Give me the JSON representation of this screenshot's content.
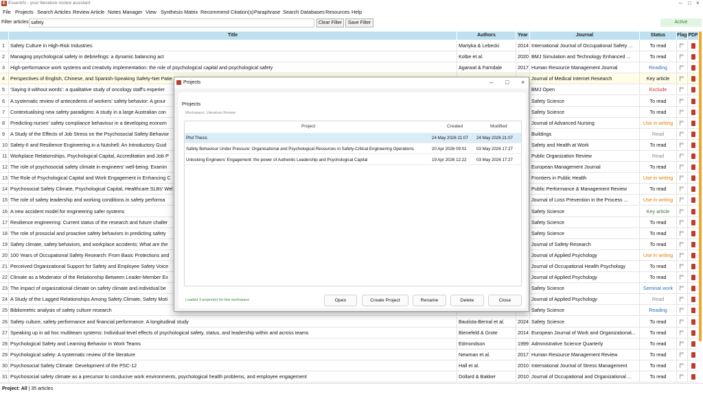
{
  "app": {
    "title": "EssentAI - your literature review assistant",
    "icon": "app-logo-icon"
  },
  "menu": [
    "File",
    "Projects",
    "Search Articles",
    "Review Article",
    "Notes Manager",
    "View",
    "Synthesis Matrix",
    "Recommend Citation(s)",
    "Paraphrase",
    "Search Databases",
    "Resources",
    "Help"
  ],
  "filter": {
    "label": "Filter articles:",
    "value": "safety",
    "clear_label": "Clear Filter",
    "save_label": "Save Filter",
    "status": "Active"
  },
  "table": {
    "headers": {
      "num": "",
      "title": "Title",
      "authors": "Authors",
      "year": "Year",
      "journal": "Journal",
      "status": "Status",
      "flag": "Flag",
      "pdf": "PDF"
    },
    "rows": [
      {
        "n": "1",
        "title": "Safety Culture in High-Risk Industries",
        "authors": "Martyka & Lebecki",
        "year": "2014",
        "journal": "International Journal of Occupational Safety ...",
        "status": "To read",
        "status_color": "#111111"
      },
      {
        "n": "2",
        "title": "Managing psychological safety in debriefings: a dynamic balancing act",
        "authors": "Kolbe et al.",
        "year": "2020",
        "journal": "BMJ Simulation and Technology Enhanced ...",
        "status": "To read",
        "status_color": "#111111"
      },
      {
        "n": "3",
        "title": "High-performance work systems and creativity implementation: the role of psychological capital and psychological safety",
        "authors": "Agarwal & Farndale",
        "year": "2017",
        "journal": "Human Resource Management Journal",
        "status": "Reading",
        "status_color": "#2f6fb5"
      },
      {
        "n": "4",
        "title": "Perspectives of English, Chinese, and Spanish-Speaking Safety-Net Patie",
        "authors": "",
        "year": "",
        "journal": "Journal of Medical Internet Research",
        "status": "Key article",
        "status_color": "#111111",
        "hl": true
      },
      {
        "n": "5",
        "title": "'Saying it without words': a qualitative study of oncology staff's experier",
        "authors": "",
        "year": "",
        "journal": "BMJ Open",
        "status": "Exclude",
        "status_color": "#d32f2f"
      },
      {
        "n": "6",
        "title": "A systematic review of antecedents of workers' safety behavior: A grour",
        "authors": "",
        "year": "",
        "journal": "Safety Science",
        "status": "To read",
        "status_color": "#111111"
      },
      {
        "n": "7",
        "title": "Contextualising new safety paradigms: A study in a large Australian con",
        "authors": "",
        "year": "",
        "journal": "Safety Science",
        "status": "To read",
        "status_color": "#111111"
      },
      {
        "n": "8",
        "title": "Predicting nurses' safety compliance behaviour in a developing econom",
        "authors": "",
        "year": "",
        "journal": "Journal of Advanced Nursing",
        "status": "Use in writing",
        "status_color": "#e07b00"
      },
      {
        "n": "9",
        "title": "A Study of the Effects of Job Stress on the Psychosocial Safety Behavior",
        "authors": "",
        "year": "",
        "journal": "Buildings",
        "status": "Read",
        "status_color": "#888888"
      },
      {
        "n": "10",
        "title": "Safety-II and Resilience Engineering in a Nutshell: An Introductory Guid",
        "authors": "",
        "year": "",
        "journal": "Safety and Health at Work",
        "status": "To read",
        "status_color": "#111111"
      },
      {
        "n": "11",
        "title": "Workplace Relationships, Psychological Capital, Accreditation and Job P",
        "authors": "",
        "year": "",
        "journal": "Public Organization Review",
        "status": "Read",
        "status_color": "#888888"
      },
      {
        "n": "12",
        "title": "The role of psychosocial safety climate in engineers' well-being: Examin",
        "authors": "",
        "year": "",
        "journal": "European Management Journal",
        "status": "To read",
        "status_color": "#111111"
      },
      {
        "n": "13",
        "title": "The Role of Psychological Capital and Work Engagement in Enhancing C",
        "authors": "",
        "year": "",
        "journal": "Frontiers in Public Health",
        "status": "Use in writing",
        "status_color": "#e07b00"
      },
      {
        "n": "14",
        "title": "Psychosocial Safety Climate, Psychological Capital, Healthcare SLBs' Wel",
        "authors": "",
        "year": "",
        "journal": "Public Performance & Management Review",
        "status": "To read",
        "status_color": "#111111"
      },
      {
        "n": "15",
        "title": "The role of safety leadership and working conditions in safety performa",
        "authors": "",
        "year": "",
        "journal": "Journal of Loss Prevention in the Process ...",
        "status": "Use in writing",
        "status_color": "#e07b00"
      },
      {
        "n": "16",
        "title": "A new accident model for engineering safer systems",
        "authors": "",
        "year": "",
        "journal": "Safety Science",
        "status": "Key article",
        "status_color": "#2e7d32"
      },
      {
        "n": "17",
        "title": "Resilience engineering: Current status of the research and future challer",
        "authors": "",
        "year": "",
        "journal": "Safety Science",
        "status": "To read",
        "status_color": "#111111"
      },
      {
        "n": "18",
        "title": "The role of prosocial and proactive safety behaviors in predicting safety",
        "authors": "",
        "year": "",
        "journal": "Safety Science",
        "status": "To read",
        "status_color": "#111111"
      },
      {
        "n": "19",
        "title": "Safety climate, safety behaviors, and workplace accidents: What are the",
        "authors": "",
        "year": "",
        "journal": "Journal of Safety Research",
        "status": "To read",
        "status_color": "#111111"
      },
      {
        "n": "20",
        "title": "100 Years of Occupational Safety Research: From Basic Protections and",
        "authors": "",
        "year": "",
        "journal": "Journal of Applied Psychology",
        "status": "Use in writing",
        "status_color": "#e07b00"
      },
      {
        "n": "21",
        "title": "Perceived Organizational Support for Safety and Employee Safety Voice",
        "authors": "",
        "year": "",
        "journal": "Journal of Occupational Health Psychology",
        "status": "To read",
        "status_color": "#111111"
      },
      {
        "n": "22",
        "title": "Climate as a Moderator of the Relationship Between Leader-Member Ex",
        "authors": "",
        "year": "",
        "journal": "Journal of Applied Psychology",
        "status": "To read",
        "status_color": "#111111"
      },
      {
        "n": "23",
        "title": "The impact of organizational climate on safety climate and individual be",
        "authors": "",
        "year": "",
        "journal": "Safety Science",
        "status": "Seminal work",
        "status_color": "#2f6fb5"
      },
      {
        "n": "24",
        "title": "A Study of the Lagged Relationships Among Safety Climate, Safety Moti",
        "authors": "",
        "year": "",
        "journal": "Journal of Applied Psychology",
        "status": "Read",
        "status_color": "#888888"
      },
      {
        "n": "25",
        "title": "Bibliometric analysis of safety culture research",
        "authors": "",
        "year": "",
        "journal": "Safety Science",
        "status": "Reading",
        "status_color": "#2f6fb5"
      },
      {
        "n": "26",
        "title": "Safety culture, safety performance and financial performance. A longitudinal study",
        "authors": "Bautista-Bernal et al.",
        "year": "2024",
        "journal": "Safety Science",
        "status": "To read",
        "status_color": "#111111"
      },
      {
        "n": "27",
        "title": "Speaking up in ad hoc multiteam systems: Individual-level effects of psychological safety, status, and leadership within and across teams",
        "authors": "Bienefeld & Grote",
        "year": "2014",
        "journal": "European Journal of Work and Organizational...",
        "status": "To read",
        "status_color": "#111111"
      },
      {
        "n": "28",
        "title": "Psychological Safety and Learning Behavior in Work Teams",
        "authors": "Edmondson",
        "year": "1999",
        "journal": "Administrative Science Quarterly",
        "status": "To read",
        "status_color": "#111111"
      },
      {
        "n": "29",
        "title": "Psychological safety: A systematic review of the literature",
        "authors": "Newman et al.",
        "year": "2017",
        "journal": "Human Resource Management Review",
        "status": "To read",
        "status_color": "#111111"
      },
      {
        "n": "30",
        "title": "Psychosocial Safety Climate: Development of the PSC-12",
        "authors": "Hall et al.",
        "year": "2010",
        "journal": "International Journal of Stress Management",
        "status": "To read",
        "status_color": "#111111"
      },
      {
        "n": "31",
        "title": "Psychosocial safety climate as a precursor to conducive work environments, psychological health problems, and employee engagement",
        "authors": "Dollard & Bakker",
        "year": "2010",
        "journal": "Journal of Occupational and Organizational ...",
        "status": "To read",
        "status_color": "#111111"
      }
    ]
  },
  "statusbar": {
    "project": "Project: All",
    "count": " | 35 articles"
  },
  "dialog": {
    "title": "Projects",
    "heading": "Projects",
    "workspace": "Workspace: Literature Review",
    "headers": {
      "project": "Project",
      "created": "Created",
      "modified": "Modified"
    },
    "projects": [
      {
        "name": "Phd Thesis",
        "created": "24 May 2026 21:07",
        "modified": "24 May 2026 21:07",
        "selected": true
      },
      {
        "name": "Safety Behaviour Under Pressure: Organisational and Psychological Resources in Safety-Critical Engineering Operations",
        "created": "20 Apr 2026 09:01",
        "modified": "03 May 2026 17:27"
      },
      {
        "name": "Unlocking Engineers' Engagement: the power of Authentic Leadership and Psychological Capital",
        "created": "19 Apr 2026 12:22",
        "modified": "03 May 2026 17:27"
      }
    ],
    "status": "Loaded 3 project(s) for this workspace.",
    "buttons": {
      "open": "Open",
      "create": "Create Project",
      "rename": "Rename",
      "delete": "Delete",
      "close": "Close"
    }
  }
}
